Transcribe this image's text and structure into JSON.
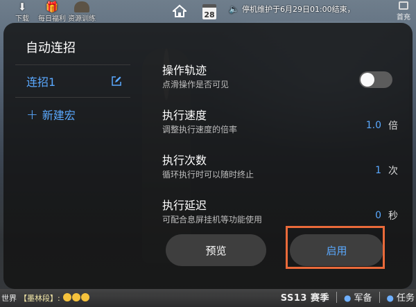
{
  "hud": {
    "download_label": "下载",
    "daily_label": "每日福利",
    "training_label": "资源训练",
    "calendar_day": "28",
    "notice_text": "停机维护于6月29日01:00结束，",
    "topup_label": "首充"
  },
  "modal": {
    "title": "自动连招",
    "macros": [
      {
        "label": "连招1"
      }
    ],
    "add_macro_label": "新建宏",
    "settings": {
      "trace": {
        "title": "操作轨迹",
        "desc": "点滑操作是否可见",
        "enabled": false
      },
      "speed": {
        "title": "执行速度",
        "desc": "调整执行速度的倍率",
        "value": "1.0",
        "unit": "倍"
      },
      "count": {
        "title": "执行次数",
        "desc": "循环执行时可以随时终止",
        "value": "1",
        "unit": "次"
      },
      "delay": {
        "title": "执行延迟",
        "desc": "可配合息屏挂机等功能使用",
        "value": "0",
        "unit": "秒"
      }
    },
    "preview_button": "预览",
    "enable_button": "启用"
  },
  "bottom": {
    "channel": "世界",
    "sender": "【墨林段】:",
    "season": "SS13 赛季",
    "armory": "军备",
    "tasks": "任务"
  },
  "colors": {
    "accent": "#5aa9ff",
    "highlight": "#ea6a3a"
  }
}
